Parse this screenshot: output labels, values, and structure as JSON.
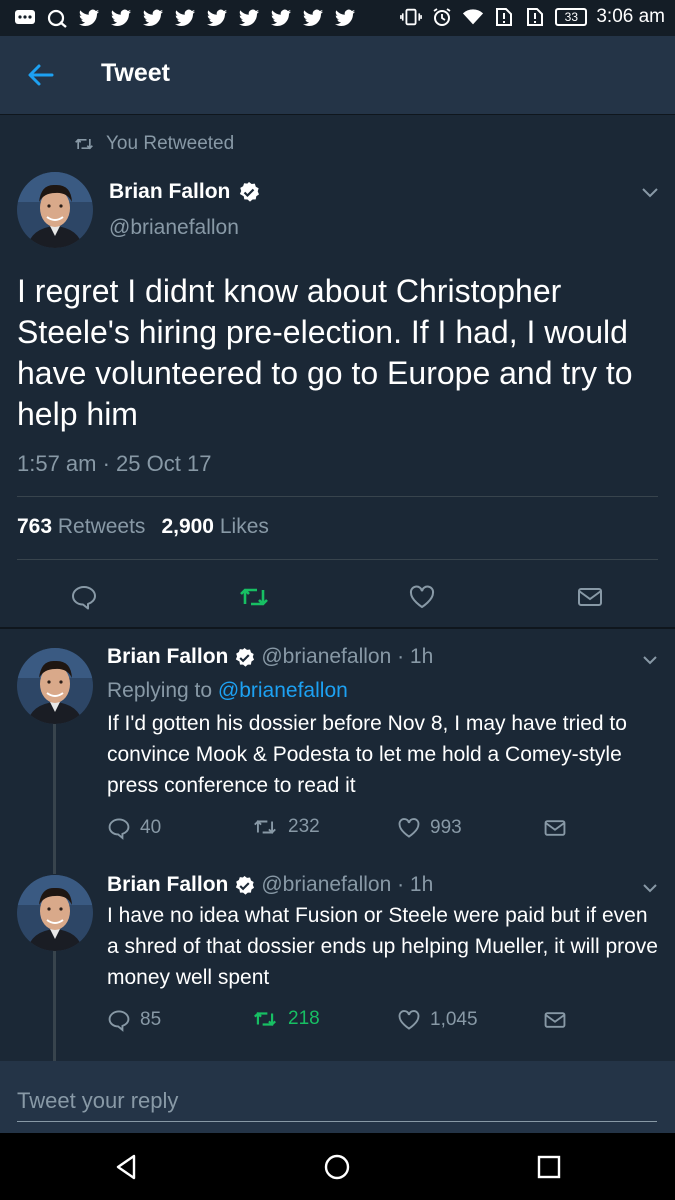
{
  "status_bar": {
    "time": "3:06 am",
    "battery": "33",
    "notification_icons": [
      "messages-icon",
      "browser-icon",
      "twitter-icon",
      "twitter-icon",
      "twitter-icon",
      "twitter-icon",
      "twitter-icon",
      "twitter-icon",
      "twitter-icon",
      "twitter-icon",
      "twitter-icon"
    ],
    "system_icons": [
      "vibrate-icon",
      "alarm-icon",
      "wifi-icon",
      "sim-alert-icon",
      "sim-alert-icon",
      "battery-icon"
    ]
  },
  "header": {
    "title": "Tweet"
  },
  "main_tweet": {
    "retweet_label": "You Retweeted",
    "author_name": "Brian Fallon",
    "handle": "@brianefallon",
    "text": "I regret I didnt know about Christopher Steele's hiring pre-election. If I had, I would have volunteered to go to Europe and try to help him",
    "timestamp": "1:57 am · 25 Oct 17",
    "retweets_count": "763",
    "retweets_label": "Retweets",
    "likes_count": "2,900",
    "likes_label": "Likes"
  },
  "replies": [
    {
      "author_name": "Brian Fallon",
      "meta": "@brianefallon · 1h",
      "replying_prefix": "Replying to",
      "replying_to": "@brianefallon",
      "text": "If I'd gotten his dossier before Nov 8, I may have tried to convince Mook & Podesta to let me hold a Comey-style press conference to read it",
      "reply_count": "40",
      "retweet_count": "232",
      "like_count": "993",
      "retweeted": false
    },
    {
      "author_name": "Brian Fallon",
      "meta": "@brianefallon · 1h",
      "text": "I have no idea what Fusion or Steele were paid but if even a shred of that dossier ends up helping Mueller, it will prove money well spent",
      "reply_count": "85",
      "retweet_count": "218",
      "like_count": "1,045",
      "retweeted": true
    }
  ],
  "composer": {
    "placeholder": "Tweet your reply"
  },
  "colors": {
    "background": "#141d26",
    "card": "#1b2836",
    "header": "#243447",
    "muted_text": "#8899a6",
    "link": "#1da1f2",
    "retweet_active": "#17bf63"
  }
}
